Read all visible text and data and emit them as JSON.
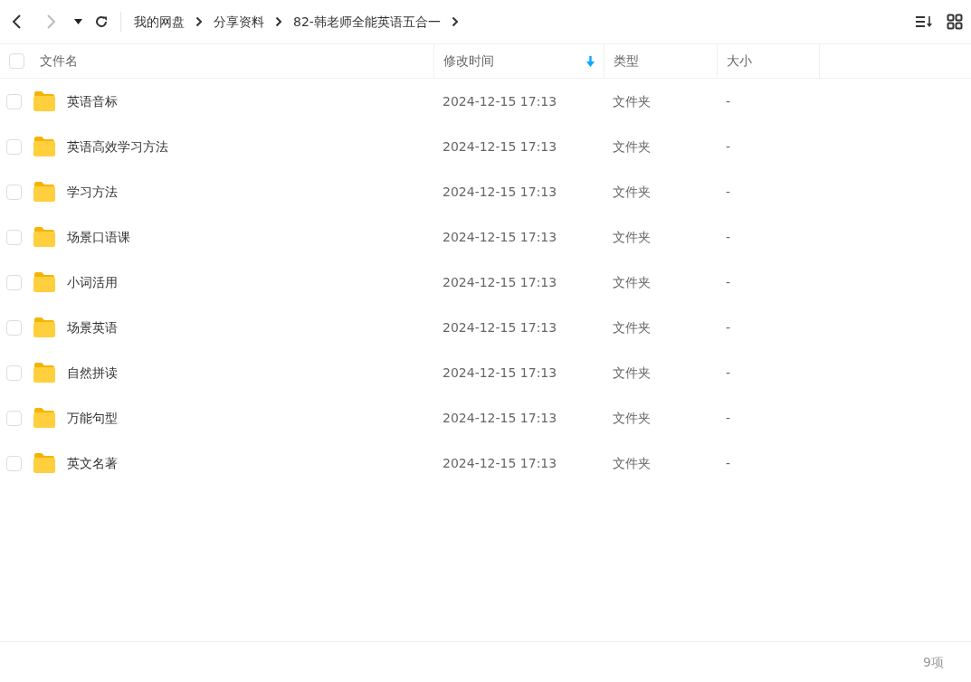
{
  "nav": {
    "back": {
      "disabled": false
    },
    "forward": {
      "disabled": true
    }
  },
  "breadcrumbs": [
    "我的网盘",
    "分享资料",
    "82-韩老师全能英语五合一"
  ],
  "table": {
    "select_all": {
      "checked": false
    },
    "columns": [
      {
        "label": "文件名",
        "sorted": false
      },
      {
        "label": "修改时间",
        "sorted": true
      },
      {
        "label": "类型",
        "sorted": false
      },
      {
        "label": "大小",
        "sorted": false
      }
    ],
    "rows": [
      {
        "name": "英语音标",
        "modified": "2024-12-15 17:13",
        "type": "文件夹",
        "size": "-",
        "checked": false
      },
      {
        "name": "英语高效学习方法",
        "modified": "2024-12-15 17:13",
        "type": "文件夹",
        "size": "-",
        "checked": false
      },
      {
        "name": "学习方法",
        "modified": "2024-12-15 17:13",
        "type": "文件夹",
        "size": "-",
        "checked": false
      },
      {
        "name": "场景口语课",
        "modified": "2024-12-15 17:13",
        "type": "文件夹",
        "size": "-",
        "checked": false
      },
      {
        "name": "小词活用",
        "modified": "2024-12-15 17:13",
        "type": "文件夹",
        "size": "-",
        "checked": false
      },
      {
        "name": "场景英语",
        "modified": "2024-12-15 17:13",
        "type": "文件夹",
        "size": "-",
        "checked": false
      },
      {
        "name": "自然拼读",
        "modified": "2024-12-15 17:13",
        "type": "文件夹",
        "size": "-",
        "checked": false
      },
      {
        "name": "万能句型",
        "modified": "2024-12-15 17:13",
        "type": "文件夹",
        "size": "-",
        "checked": false
      },
      {
        "name": "英文名著",
        "modified": "2024-12-15 17:13",
        "type": "文件夹",
        "size": "-",
        "checked": false
      }
    ]
  },
  "status_bar": {
    "count": "9项"
  }
}
